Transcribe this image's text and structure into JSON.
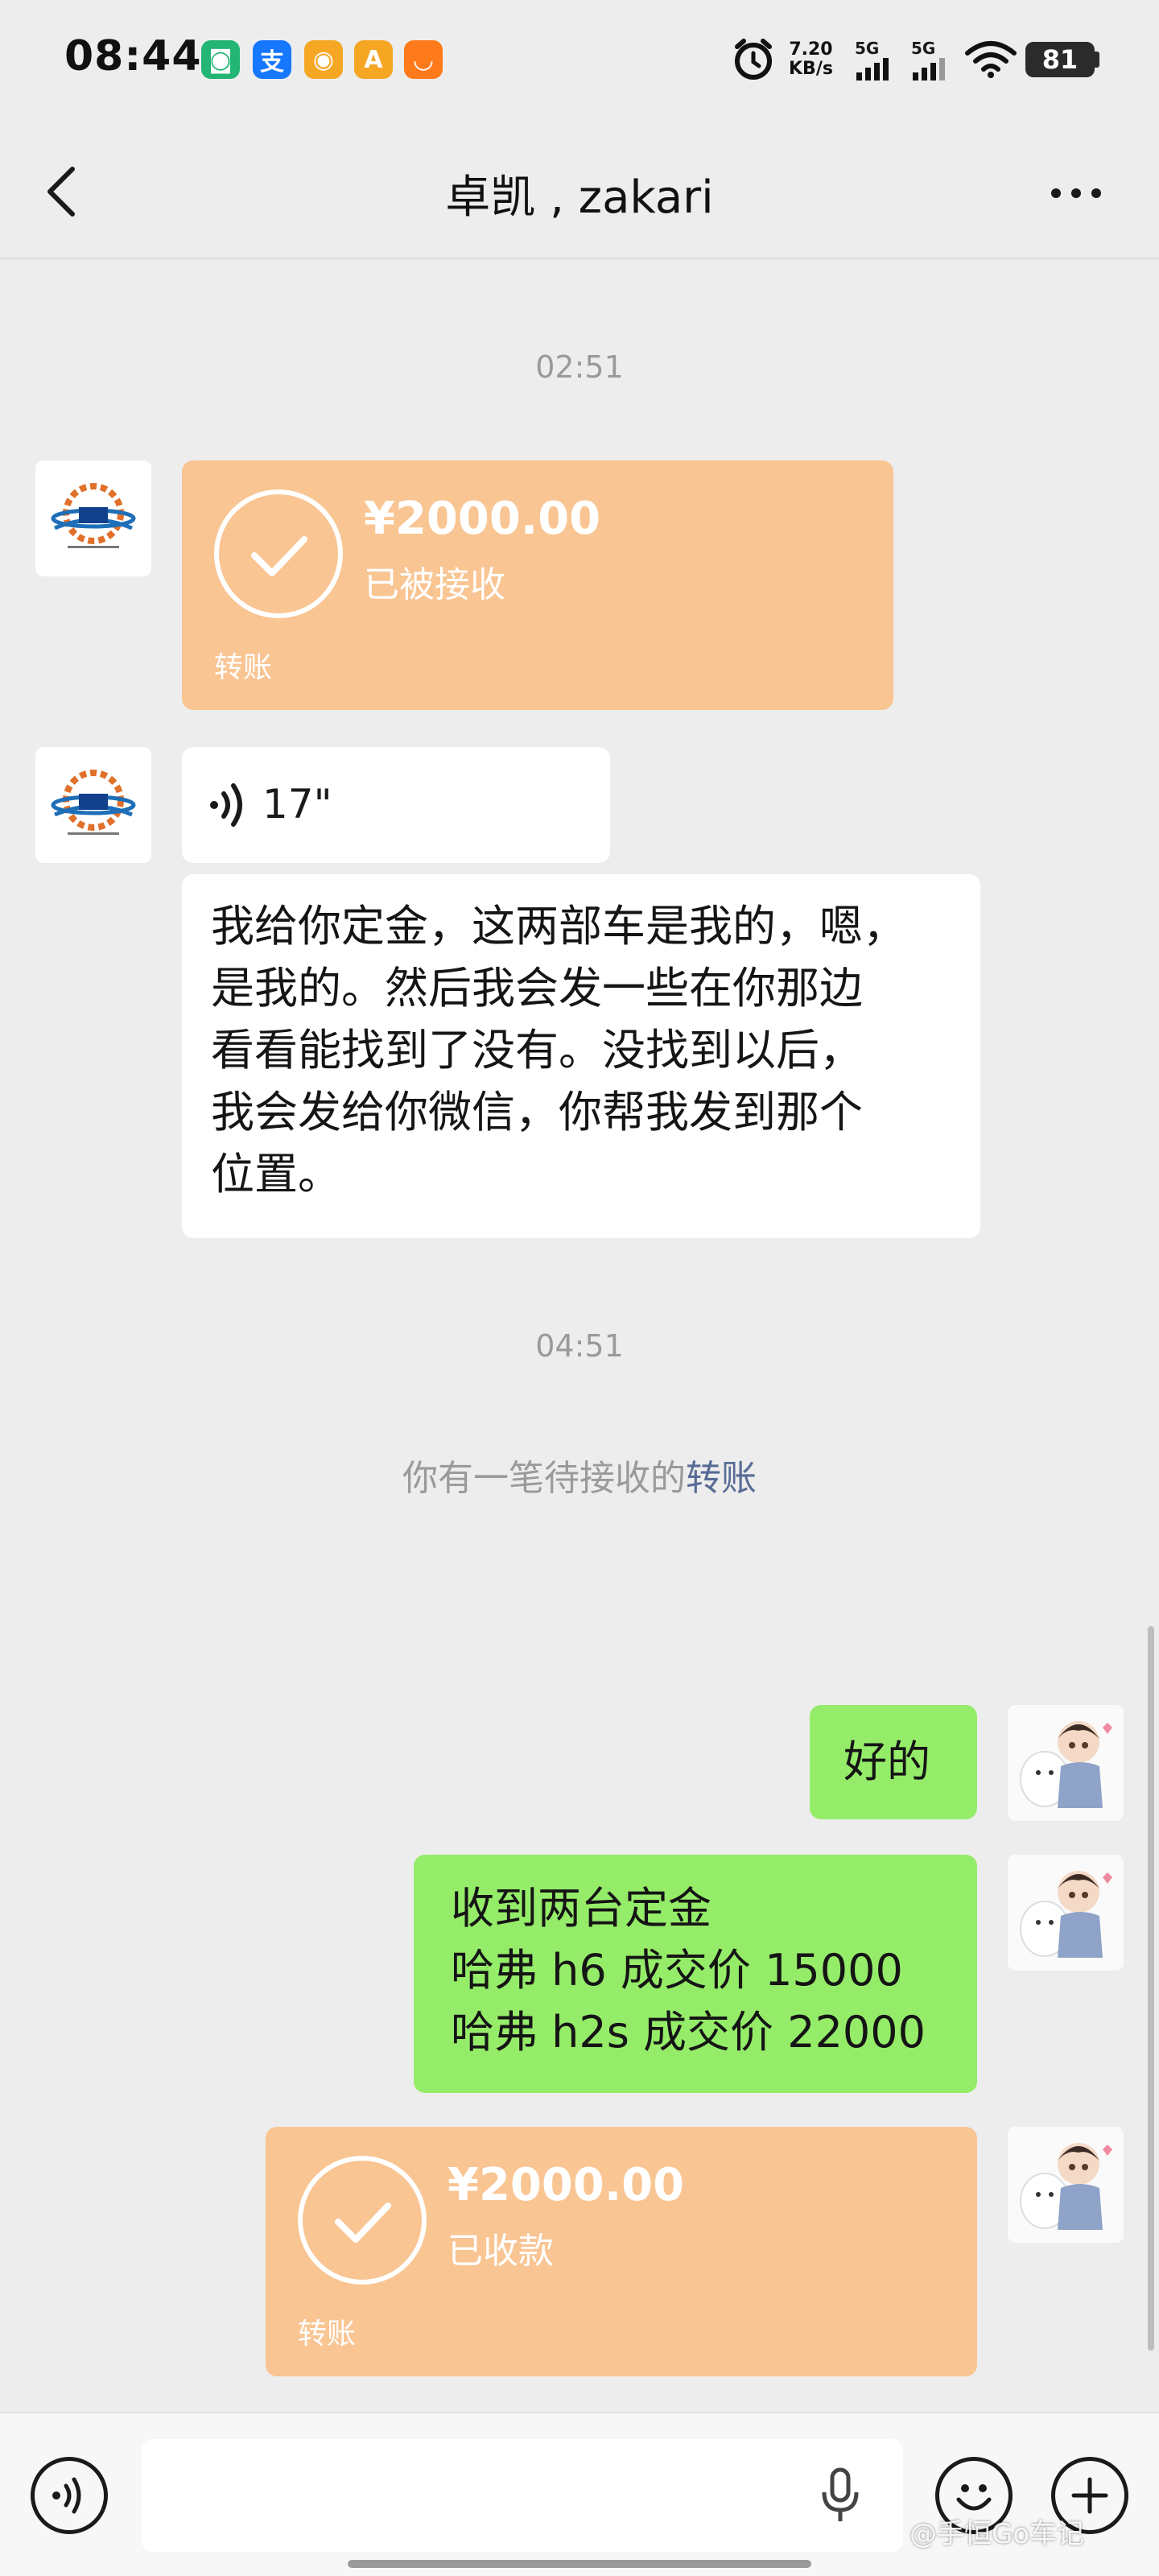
{
  "status_bar": {
    "time": "08:44",
    "app_icons": [
      {
        "name": "mi-app-icon",
        "glyph": "◙",
        "color": "#22b573"
      },
      {
        "name": "alipay-icon",
        "glyph": "支",
        "color": "#1677ff"
      },
      {
        "name": "weibo-icon",
        "glyph": "◉",
        "color": "#f5a623"
      },
      {
        "name": "amap-icon",
        "glyph": "A",
        "color": "#f5a623"
      },
      {
        "name": "didi-icon",
        "glyph": "◡",
        "color": "#ff7a1a"
      }
    ],
    "net_speed": "7.20",
    "net_unit": "KB/s",
    "sim1": "5G",
    "sim2": "5G",
    "battery": "81"
  },
  "header": {
    "title": "卓凯 , zakari"
  },
  "messages": {
    "time1": "02:51",
    "incoming_transfer": {
      "amount": "¥2000.00",
      "status": "已被接收",
      "label": "转账"
    },
    "voice": {
      "duration": "17\""
    },
    "incoming_text": {
      "lines": [
        "我给你定金，这两部车是我的，嗯，",
        "是我的。然后我会发一些在你那边",
        "看看能找到了没有。没找到以后，",
        "我会发给你微信，你帮我发到那个",
        "位置。"
      ]
    },
    "time2": "04:51",
    "notice": {
      "prefix": "你有一笔待接收的",
      "link": "转账"
    },
    "outgoing_ok": {
      "text": "好的"
    },
    "outgoing_text": {
      "lines": [
        "收到两台定金",
        "哈弗 h6 成交价 15000",
        "哈弗 h2s 成交价 22000"
      ]
    },
    "outgoing_transfer": {
      "amount": "¥2000.00",
      "status": "已收款",
      "label": "转账"
    }
  },
  "watermark": "@手恒Go车记",
  "colors": {
    "background": "#ededed",
    "transfer": "#f9c593",
    "outgoing_bubble": "#95ec69",
    "incoming_bubble": "#ffffff",
    "link": "#576b95"
  }
}
